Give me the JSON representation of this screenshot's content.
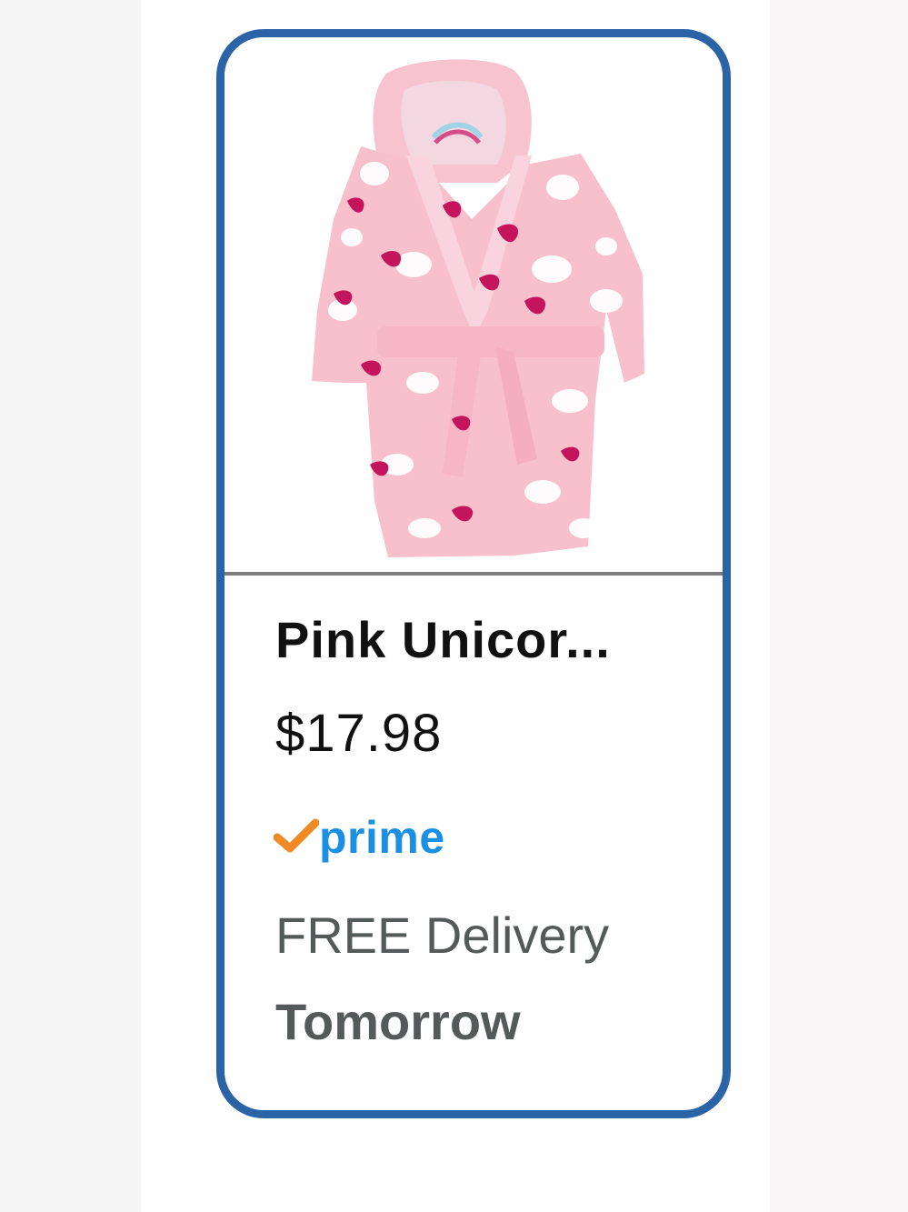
{
  "product": {
    "title": "Pink Unicor...",
    "price": "$17.98",
    "image_description": "pink-unicorn-hooded-robe",
    "prime_label": "prime",
    "delivery_line": "FREE Delivery",
    "delivery_day": "Tomorrow"
  },
  "colors": {
    "card_border": "#2a64a6",
    "prime_blue": "#1a8fe3",
    "prime_check": "#f08a24",
    "delivery_text": "#565959"
  },
  "icons": {
    "prime_check": "checkmark-icon"
  }
}
